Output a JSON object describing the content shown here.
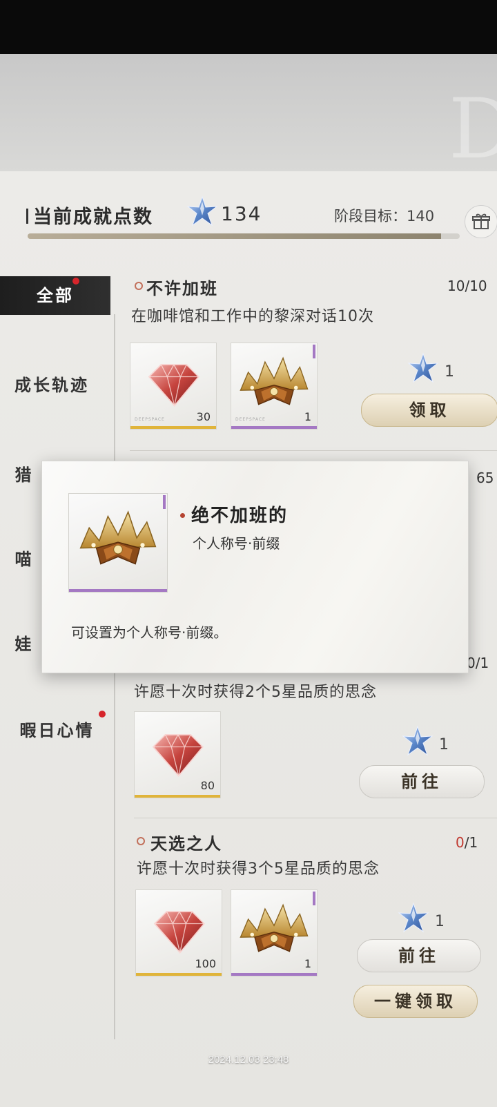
{
  "header": {
    "title": "当前成就点数",
    "points": "134",
    "goal": "阶段目标：140",
    "progress_fraction": 0.957
  },
  "sidebar": {
    "items": [
      {
        "label": "全部",
        "active": true,
        "badge": true
      },
      {
        "label": "成长轨迹",
        "active": false,
        "badge": false
      },
      {
        "label": "猎",
        "active": false,
        "badge": false
      },
      {
        "label": "喵",
        "active": false,
        "badge": false
      },
      {
        "label": "娃",
        "active": false,
        "badge": false
      },
      {
        "label": "暇日心情",
        "active": false,
        "badge": true
      }
    ]
  },
  "achievements": [
    {
      "title": "不许加班",
      "progress_current": "10/10",
      "desc": "在咖啡馆和工作中的黎深对话10次",
      "rewards": [
        {
          "icon": "red-diamond-icon",
          "qty": "30",
          "rarity_color": "#e0b43a"
        },
        {
          "icon": "gold-crown-icon",
          "qty": "1",
          "rarity_color": "#a478c3"
        }
      ],
      "points": "1",
      "button": "领取"
    },
    {
      "title": "",
      "progress_current": "65",
      "desc": "",
      "rewards": [],
      "points": "",
      "button": ""
    },
    {
      "title": "",
      "progress_partial": "0/1",
      "desc": "许愿十次时获得2个5星品质的思念",
      "rewards": [
        {
          "icon": "red-diamond-icon",
          "qty": "80",
          "rarity_color": "#e0b43a"
        }
      ],
      "points": "1",
      "button": "前往"
    },
    {
      "title": "天选之人",
      "progress_cur": "0",
      "progress_total": "/1",
      "desc": "许愿十次时获得3个5星品质的思念",
      "rewards": [
        {
          "icon": "red-diamond-icon",
          "qty": "100",
          "rarity_color": "#e0b43a"
        },
        {
          "icon": "gold-crown-icon",
          "qty": "1",
          "rarity_color": "#a478c3"
        }
      ],
      "points": "1",
      "button": "前往"
    }
  ],
  "claim_all_button": "一键领取",
  "popup": {
    "name": "绝不加班的",
    "type": "个人称号·前缀",
    "desc": "可设置为个人称号·前缀。",
    "icon": "gold-crown-icon"
  },
  "timestamp": "2024.12.03 23:48",
  "colors": {
    "star_blue": "#5a86c9",
    "accent_red": "#c0382f",
    "gold_bar": "#e0b43a",
    "purple_bar": "#a478c3"
  }
}
